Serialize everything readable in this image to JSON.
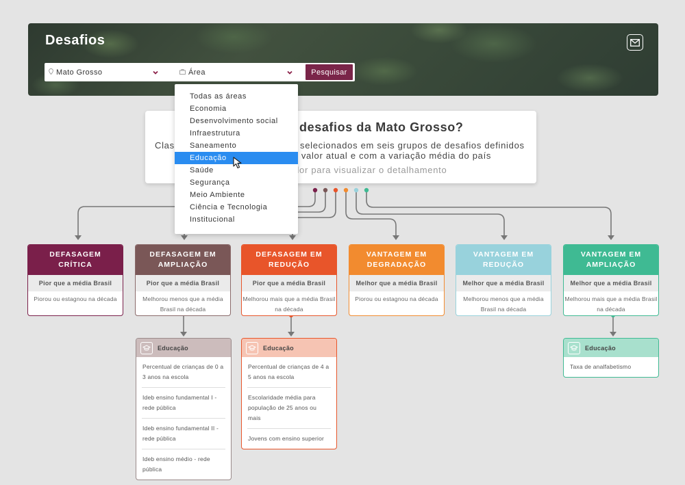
{
  "header": {
    "title": "Desafios",
    "mail_icon": "envelope-icon",
    "state_select": {
      "icon": "map-pin-icon",
      "value": "Mato Grosso"
    },
    "area_select": {
      "icon": "briefcase-icon",
      "value": "Área"
    },
    "search_label": "Pesquisar",
    "accent": "#7a2549"
  },
  "info": {
    "title": "desafios da Mato Grosso?",
    "line1_start": "Class",
    "line1_end": "selecionados em seis grupos de desafios definidos",
    "line2": "m valor atual e com a variação média do país",
    "line3": "cador para visualizar o detalhamento"
  },
  "dropdown": {
    "items": [
      "Todas as áreas",
      "Economia",
      "Desenvolvimento social",
      "Infraestrutura",
      "Saneamento",
      "Educação",
      "Saúde",
      "Segurança",
      "Meio Ambiente",
      "Ciência e Tecnologia",
      "Institucional"
    ],
    "selected": "Educação"
  },
  "categories": [
    {
      "title": "DEFASAGEM CRÍTICA",
      "sub": "Pior que a média Brasil",
      "desc": "Piorou ou estagnou na década",
      "color": "#7a1f4a",
      "border": "#7a1f4a"
    },
    {
      "title": "DEFASAGEM EM AMPLIAÇÃO",
      "sub": "Pior que a média Brasil",
      "desc": "Melhorou menos que  a média Brasil na década",
      "color": "#7a5757",
      "border": "#8a6a6a"
    },
    {
      "title": "DEFASAGEM EM REDUÇÃO",
      "sub": "Pior que a média Brasil",
      "desc": "Melhorou mais que a média Brasil na década",
      "color": "#e8552a",
      "border": "#e8552a"
    },
    {
      "title": "VANTAGEM EM DEGRADAÇÃO",
      "sub": "Melhor que a média Brasil",
      "desc": "Piorou ou estagnou na década",
      "color": "#f28b2f",
      "border": "#f28b2f"
    },
    {
      "title": "VANTAGEM EM REDUÇÃO",
      "sub": "Melhor que a média Brasil",
      "desc": "Melhorou menos que a média Brasil na década",
      "color": "#98d2dc",
      "border": "#98d2dc"
    },
    {
      "title": "VANTAGEM EM AMPLIAÇÃO",
      "sub": "Melhor que a média Brasil",
      "desc": "Melhorou mais que a média Brasil na década",
      "color": "#3fba93",
      "border": "#3fba93"
    }
  ],
  "indicators": [
    {
      "area": "Educação",
      "head_color": "#ccbcbc",
      "border": "#9a8a8a",
      "items": [
        "Percentual de crianças de 0 a 3 anos na escola",
        "Ideb ensino fundamental I - rede pública",
        "Ideb ensino fundamental II - rede pública",
        "Ideb ensino médio - rede pública"
      ]
    },
    {
      "area": "Educação",
      "head_color": "#f6c4b3",
      "border": "#e8552a",
      "items": [
        "Percentual de crianças de 4 a 5 anos na escola",
        "Escolaridade média para população de 25 anos ou mais",
        "Jovens com ensino superior"
      ]
    },
    {
      "area": "Educação",
      "head_color": "#a8e0cd",
      "border": "#3fba93",
      "items": [
        "Taxa de analfabetismo"
      ]
    }
  ],
  "dot_colors": [
    "#7a1f4a",
    "#7a5757",
    "#e8552a",
    "#f28b2f",
    "#98d2dc",
    "#3fba93"
  ],
  "connector_color": "#777777"
}
